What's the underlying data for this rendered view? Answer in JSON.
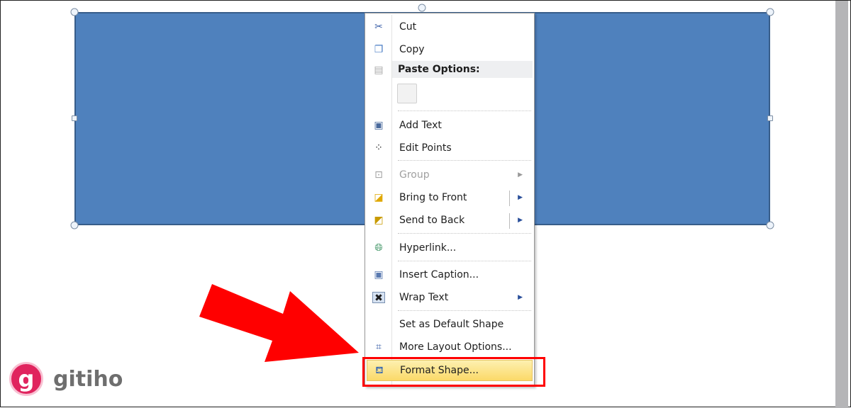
{
  "colors": {
    "shape_fill": "#4f81bd",
    "highlight": "#fbd968",
    "annotation": "#ff0000",
    "logo": "#e0245e"
  },
  "menu": {
    "cut": {
      "label": "Cut",
      "icon": "scissors-icon"
    },
    "copy": {
      "label": "Copy",
      "icon": "copy-icon"
    },
    "paste_options": {
      "label": "Paste Options:",
      "icon": "paste-icon"
    },
    "add_text": {
      "label": "Add Text",
      "icon": "text-box-icon"
    },
    "edit_points": {
      "label": "Edit Points",
      "icon": "edit-points-icon"
    },
    "group": {
      "label": "Group",
      "icon": "group-icon",
      "disabled": true
    },
    "bring_to_front": {
      "label": "Bring to Front",
      "icon": "bring-front-icon"
    },
    "send_to_back": {
      "label": "Send to Back",
      "icon": "send-back-icon"
    },
    "hyperlink": {
      "label": "Hyperlink...",
      "icon": "globe-link-icon"
    },
    "insert_caption": {
      "label": "Insert Caption...",
      "icon": "caption-icon"
    },
    "wrap_text": {
      "label": "Wrap Text",
      "icon": "wrap-text-icon"
    },
    "set_default": {
      "label": "Set as Default Shape"
    },
    "more_layout": {
      "label": "More Layout Options...",
      "icon": "layout-icon"
    },
    "format_shape": {
      "label": "Format Shape...",
      "icon": "paint-bucket-icon"
    }
  },
  "logo": {
    "text": "gitiho",
    "mark": "g"
  }
}
